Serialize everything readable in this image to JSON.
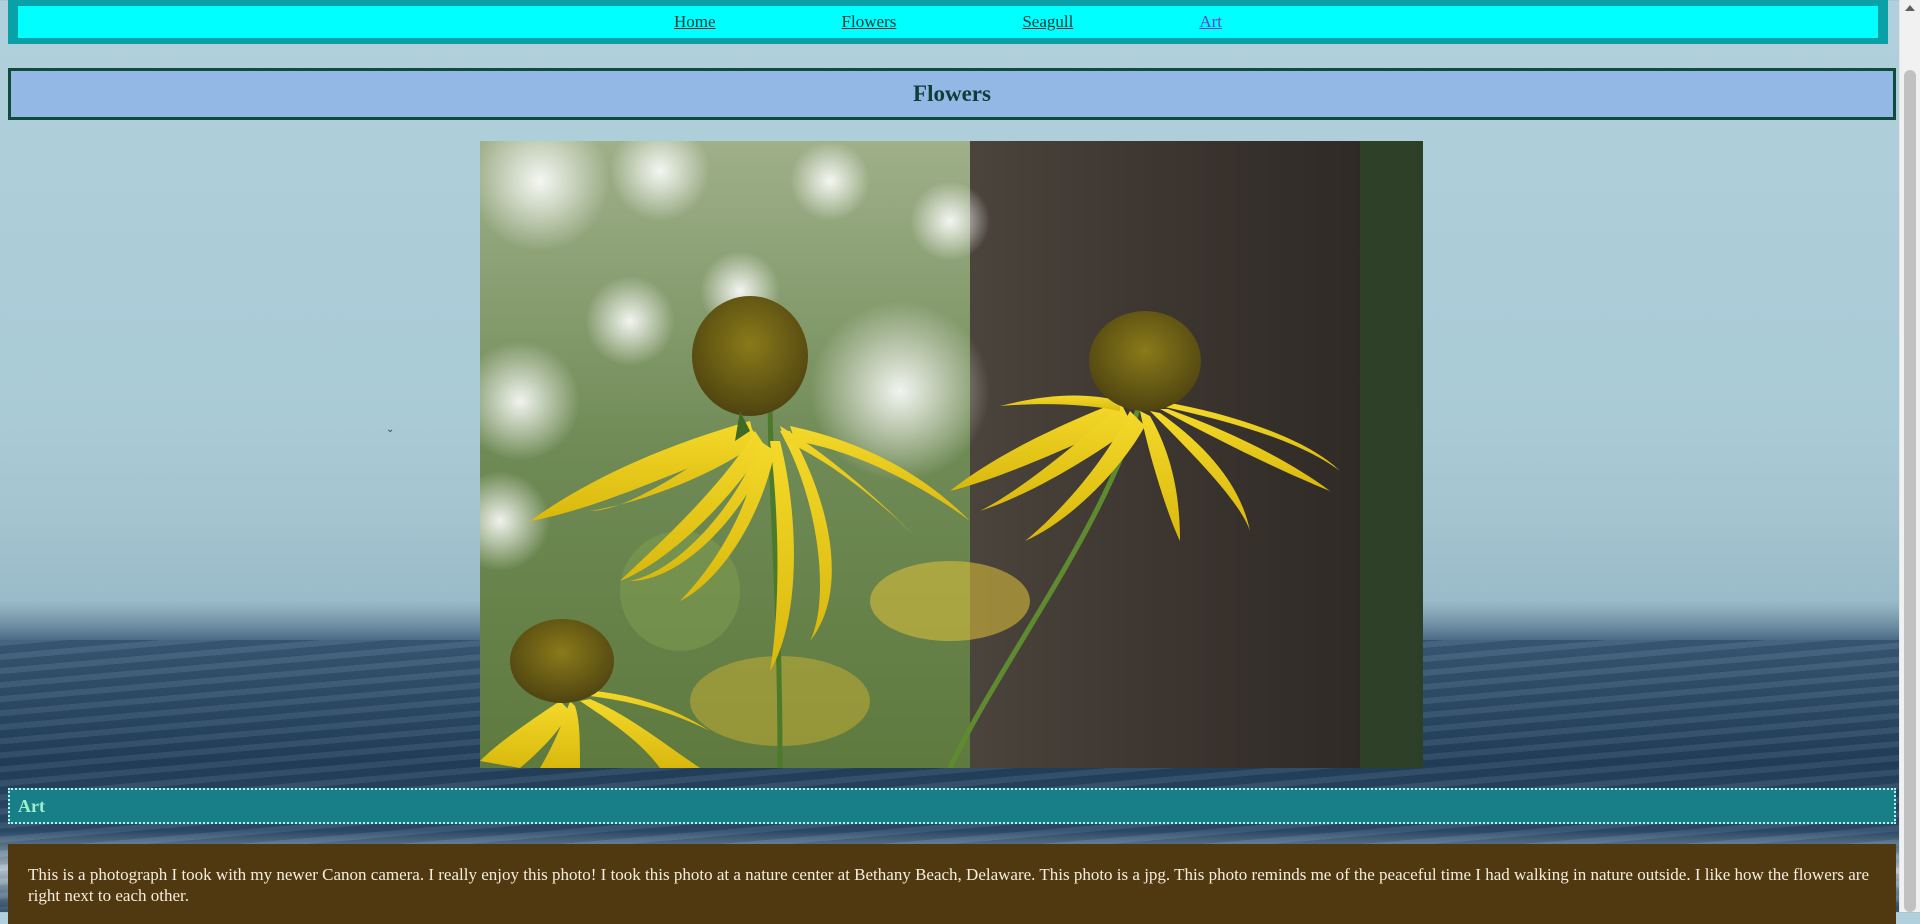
{
  "nav": {
    "items": [
      {
        "label": "Home"
      },
      {
        "label": "Flowers"
      },
      {
        "label": "Seagull"
      },
      {
        "label": "Art"
      }
    ]
  },
  "header": {
    "title": "Flowers"
  },
  "photo": {
    "subject": "flower-photo"
  },
  "art": {
    "heading": "Art"
  },
  "description": {
    "text": "This is a photograph I took with my newer Canon camera. I really enjoy this photo! I took this photo at a nature center at Bethany Beach, Delaware. This photo is a jpg. This photo reminds me of the peaceful time I had walking in nature outside. I like how the flowers are right next to each other."
  },
  "colors": {
    "nav_outer": "#0aa0a8",
    "nav_inner": "#00ffff",
    "header_bg": "#93b8e6",
    "header_border": "#0f4d3a",
    "art_bg": "#187e88",
    "desc_bg": "#503810"
  }
}
